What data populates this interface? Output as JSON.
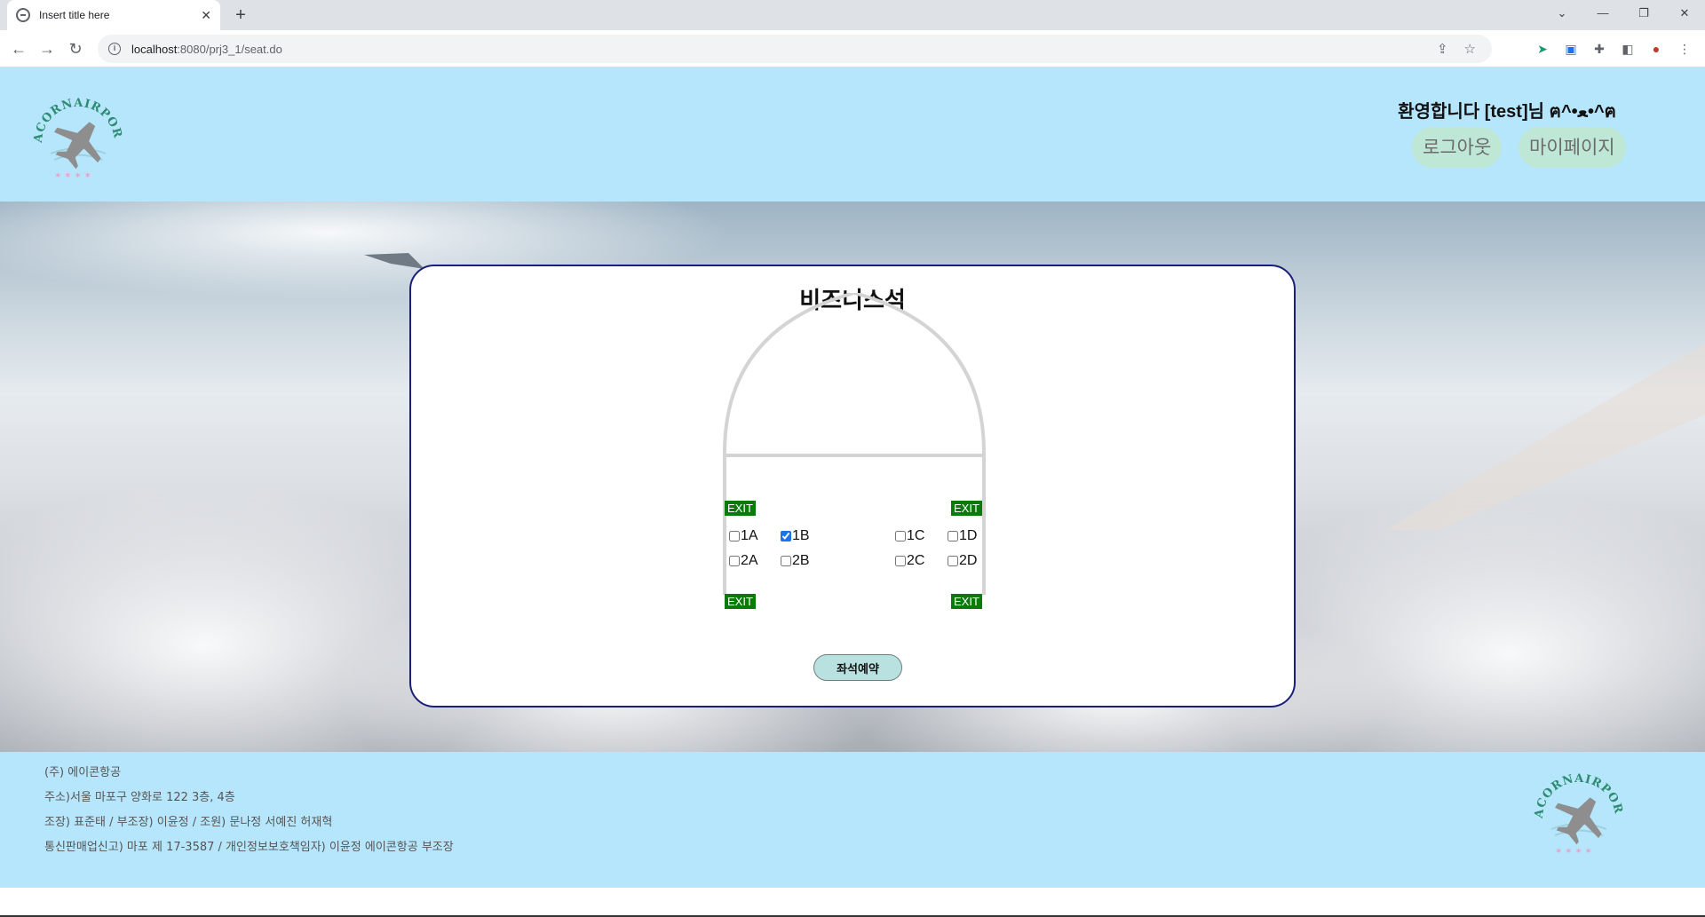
{
  "browser": {
    "tab_title": "Insert title here",
    "tab_close": "✕",
    "new_tab": "+",
    "url_host": "localhost",
    "url_rest": ":8080/prj3_1/seat.do",
    "window_controls": [
      "⌄",
      "—",
      "❐",
      "✕"
    ],
    "nav": {
      "back": "←",
      "forward": "→",
      "reload": "↻"
    }
  },
  "header": {
    "logo_text": "ACORNAIRPORT",
    "welcome": "환영합니다 [test]님 ฅ^•ﻌ•^ฅ",
    "logout_label": "로그아웃",
    "mypage_label": "마이페이지"
  },
  "seat_card": {
    "title": "비즈니스석",
    "exit_label": "EXIT",
    "seats": [
      {
        "label": "1A",
        "checked": false
      },
      {
        "label": "1B",
        "checked": true
      },
      {
        "label": "1C",
        "checked": false
      },
      {
        "label": "1D",
        "checked": false
      },
      {
        "label": "2A",
        "checked": false
      },
      {
        "label": "2B",
        "checked": false
      },
      {
        "label": "2C",
        "checked": false
      },
      {
        "label": "2D",
        "checked": false
      }
    ],
    "reserve_label": "좌석예약"
  },
  "footer": {
    "lines": [
      "(주) 에이콘항공",
      "주소)서울 마포구 양화로 122 3층, 4층",
      "조장) 표준태 / 부조장) 이윤정 / 조원) 문나정 서예진 허재혁",
      "통신판매업신고) 마포 제 17-3587 / 개인정보보호책임자) 이윤정 에이콘항공 부조장"
    ],
    "logo_text": "ACORNAIRPORT"
  },
  "colors": {
    "header_bg": "#b6e6fb",
    "card_border": "#1c1f7a",
    "exit_bg": "#0a7a0a",
    "button_bg": "#bfe7d6",
    "reserve_bg": "#b9e1e0"
  }
}
